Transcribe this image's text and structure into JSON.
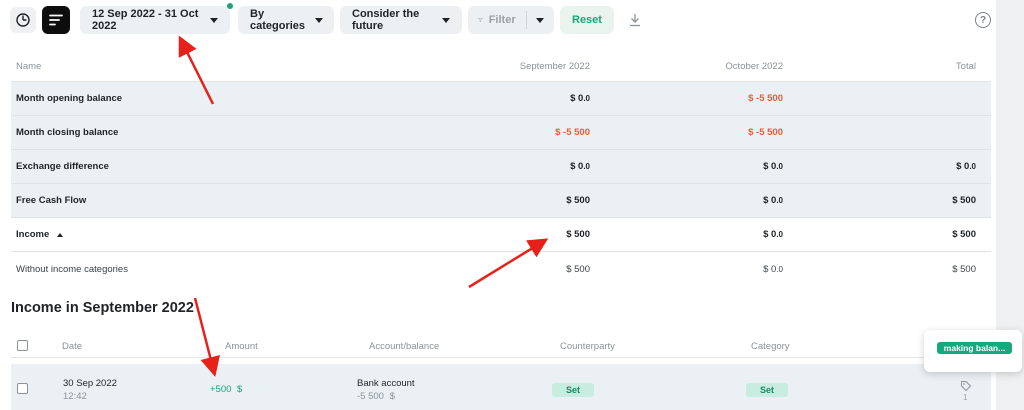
{
  "toolbar": {
    "date_range": "12 Sep 2022 - 31 Oct 2022",
    "group_by": "By categories",
    "future": "Consider the future",
    "filter": "Filter",
    "reset": "Reset",
    "help": "?",
    "icons": [
      "clock-icon",
      "report-lines-icon",
      "filter-funnel-icon",
      "download-icon",
      "help-icon"
    ]
  },
  "summary": {
    "columns": {
      "name": "Name",
      "sep": "September 2022",
      "oct": "October 2022",
      "total": "Total"
    },
    "rows": [
      {
        "name": "Month opening balance",
        "sep": "$ 0",
        "sep_c": ".0",
        "oct": "$ -5 500",
        "oct_c": "",
        "total": "",
        "total_c": ""
      },
      {
        "name": "Month closing balance",
        "sep": "$ -5 500",
        "sep_c": "",
        "oct": "$ -5 500",
        "oct_c": "",
        "total": "",
        "total_c": ""
      },
      {
        "name": "Exchange difference",
        "sep": "$ 0",
        "sep_c": ".0",
        "oct": "$ 0",
        "oct_c": ".0",
        "total": "$ 0",
        "total_c": ".0"
      },
      {
        "name": "Free Cash Flow",
        "sep": "$ 500",
        "sep_c": "",
        "oct": "$ 0",
        "oct_c": ".0",
        "total": "$ 500",
        "total_c": ""
      },
      {
        "name": "Income",
        "sep": "$ 500",
        "sep_c": "",
        "oct": "$ 0",
        "oct_c": ".0",
        "total": "$ 500",
        "total_c": ""
      },
      {
        "name": "Without income categories",
        "sep": "$ 500",
        "sep_c": "",
        "oct": "$ 0",
        "oct_c": ".0",
        "total": "$ 500",
        "total_c": ""
      }
    ]
  },
  "section": {
    "title": "Income in September 2022"
  },
  "transactions": {
    "columns": {
      "date": "Date",
      "amount": "Amount",
      "account": "Account/balance",
      "counterparty": "Counterparty",
      "category": "Category"
    },
    "rows": [
      {
        "date": "30 Sep 2022",
        "time": "12:42",
        "amount": "+500",
        "currency": "$",
        "account": "Bank account",
        "balance": "-5 500",
        "balance_currency": "$",
        "counterparty": "Set",
        "category": "Set",
        "tag_count": "1"
      }
    ]
  },
  "tooltip": {
    "text": "making balan..."
  },
  "colors": {
    "accent": "#1aa57a",
    "negative": "#ee5a36",
    "row_shade": "#eaf0f4",
    "annotation": "#e8201a"
  }
}
